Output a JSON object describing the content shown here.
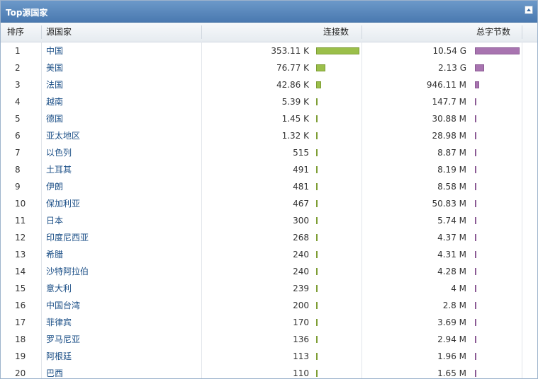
{
  "panel": {
    "title": "Top源国家"
  },
  "table": {
    "columns": {
      "rank": "排序",
      "country": "源国家",
      "connections": "连接数",
      "bytes": "总字节数"
    },
    "max_connections": 353110,
    "max_bytes": 10540000000,
    "rows": [
      {
        "rank": "1",
        "country": "中国",
        "connections": "353.11 K",
        "conn_value": 353110,
        "bytes": "10.54 G",
        "bytes_value": 10540000000
      },
      {
        "rank": "2",
        "country": "美国",
        "connections": "76.77 K",
        "conn_value": 76770,
        "bytes": "2.13 G",
        "bytes_value": 2130000000
      },
      {
        "rank": "3",
        "country": "法国",
        "connections": "42.86 K",
        "conn_value": 42860,
        "bytes": "946.11 M",
        "bytes_value": 946110000
      },
      {
        "rank": "4",
        "country": "越南",
        "connections": "5.39 K",
        "conn_value": 5390,
        "bytes": "147.7 M",
        "bytes_value": 147700000
      },
      {
        "rank": "5",
        "country": "德国",
        "connections": "1.45 K",
        "conn_value": 1450,
        "bytes": "30.88 M",
        "bytes_value": 30880000
      },
      {
        "rank": "6",
        "country": "亚太地区",
        "connections": "1.32 K",
        "conn_value": 1320,
        "bytes": "28.98 M",
        "bytes_value": 28980000
      },
      {
        "rank": "7",
        "country": "以色列",
        "connections": "515",
        "conn_value": 515,
        "bytes": "8.87 M",
        "bytes_value": 8870000
      },
      {
        "rank": "8",
        "country": "土耳其",
        "connections": "491",
        "conn_value": 491,
        "bytes": "8.19 M",
        "bytes_value": 8190000
      },
      {
        "rank": "9",
        "country": "伊朗",
        "connections": "481",
        "conn_value": 481,
        "bytes": "8.58 M",
        "bytes_value": 8580000
      },
      {
        "rank": "10",
        "country": "保加利亚",
        "connections": "467",
        "conn_value": 467,
        "bytes": "50.83 M",
        "bytes_value": 50830000
      },
      {
        "rank": "11",
        "country": "日本",
        "connections": "300",
        "conn_value": 300,
        "bytes": "5.74 M",
        "bytes_value": 5740000
      },
      {
        "rank": "12",
        "country": "印度尼西亚",
        "connections": "268",
        "conn_value": 268,
        "bytes": "4.37 M",
        "bytes_value": 4370000
      },
      {
        "rank": "13",
        "country": "希腊",
        "connections": "240",
        "conn_value": 240,
        "bytes": "4.31 M",
        "bytes_value": 4310000
      },
      {
        "rank": "14",
        "country": "沙特阿拉伯",
        "connections": "240",
        "conn_value": 240,
        "bytes": "4.28 M",
        "bytes_value": 4280000
      },
      {
        "rank": "15",
        "country": "意大利",
        "connections": "239",
        "conn_value": 239,
        "bytes": "4 M",
        "bytes_value": 4000000
      },
      {
        "rank": "16",
        "country": "中国台湾",
        "connections": "200",
        "conn_value": 200,
        "bytes": "2.8 M",
        "bytes_value": 2800000
      },
      {
        "rank": "17",
        "country": "菲律宾",
        "connections": "170",
        "conn_value": 170,
        "bytes": "3.69 M",
        "bytes_value": 3690000
      },
      {
        "rank": "18",
        "country": "罗马尼亚",
        "connections": "136",
        "conn_value": 136,
        "bytes": "2.94 M",
        "bytes_value": 2940000
      },
      {
        "rank": "19",
        "country": "阿根廷",
        "connections": "113",
        "conn_value": 113,
        "bytes": "1.96 M",
        "bytes_value": 1960000
      },
      {
        "rank": "20",
        "country": "巴西",
        "connections": "110",
        "conn_value": 110,
        "bytes": "1.65 M",
        "bytes_value": 1650000
      }
    ]
  },
  "colors": {
    "conn_bar": "#9bbf4a",
    "bytes_bar": "#a874b0",
    "header": "#4a79b0"
  }
}
